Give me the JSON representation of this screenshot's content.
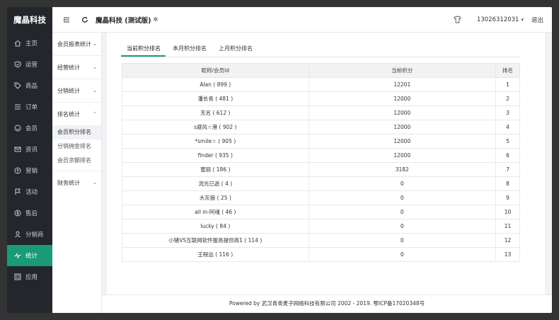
{
  "brand": "魔晶科技",
  "nav": [
    {
      "label": "主页",
      "icon": "home-icon"
    },
    {
      "label": "运营",
      "icon": "shield-icon"
    },
    {
      "label": "商品",
      "icon": "tag-icon"
    },
    {
      "label": "订单",
      "icon": "list-icon"
    },
    {
      "label": "会员",
      "icon": "user-smile-icon"
    },
    {
      "label": "资讯",
      "icon": "mail-icon"
    },
    {
      "label": "营销",
      "icon": "coin-icon"
    },
    {
      "label": "活动",
      "icon": "flag-icon"
    },
    {
      "label": "售后",
      "icon": "dollar-icon"
    },
    {
      "label": "分销商",
      "icon": "person-icon"
    },
    {
      "label": "统计",
      "icon": "pulse-icon"
    },
    {
      "label": "应用",
      "icon": "app-icon"
    }
  ],
  "subnav": {
    "groups": [
      {
        "title": "会员报表统计",
        "chevron": "⌄"
      },
      {
        "title": "经营统计",
        "chevron": "⌄"
      },
      {
        "title": "分销统计",
        "chevron": "⌄"
      },
      {
        "title": "排名统计",
        "chevron": "⌃"
      },
      {
        "title": "财务统计",
        "chevron": "⌄"
      }
    ],
    "rank_items": [
      "会员积分排名",
      "分销佣金排名",
      "会员余额排名"
    ]
  },
  "topbar": {
    "store_name": "魔晶科技 (测试版)",
    "gear": "✲",
    "phone": "13026312031",
    "caret": "▾",
    "logout": "退出"
  },
  "tabs": [
    "当前积分排名",
    "本月积分排名",
    "上月积分排名"
  ],
  "table": {
    "headers": [
      "昵称/会员Id",
      "当前积分",
      "排名"
    ],
    "rows": [
      [
        "Alan ( 899 )",
        "12201",
        "1"
      ],
      [
        "潘长青 ( 481 )",
        "12000",
        "2"
      ],
      [
        "无名 ( 612 )",
        "12000",
        "3"
      ],
      [
        "s避风☆港 ( 902 )",
        "12000",
        "4"
      ],
      [
        "*smile☆ ( 905 )",
        "12000",
        "5"
      ],
      [
        "finder ( 935 )",
        "12000",
        "6"
      ],
      [
        "蜜丽 ( 186 )",
        "3182",
        "7"
      ],
      [
        "流光已逝 ( 4 )",
        "0",
        "8"
      ],
      [
        "大灰狼 ( 25 )",
        "0",
        "9"
      ],
      [
        "all in-阿魂 ( 46 )",
        "0",
        "10"
      ],
      [
        "lucky ( 84 )",
        "0",
        "11"
      ],
      [
        "小猪VS互联网软件服务提供商1 ( 114 )",
        "0",
        "12"
      ],
      [
        "王程远 ( 116 )",
        "0",
        "13"
      ]
    ]
  },
  "footer": "Powered by 武汉青青麦子网络科技有限公司 2002 - 2019. 鄂ICP备17020348号",
  "colors": {
    "accent": "#1a9b78",
    "nav_bg": "#23262b"
  }
}
